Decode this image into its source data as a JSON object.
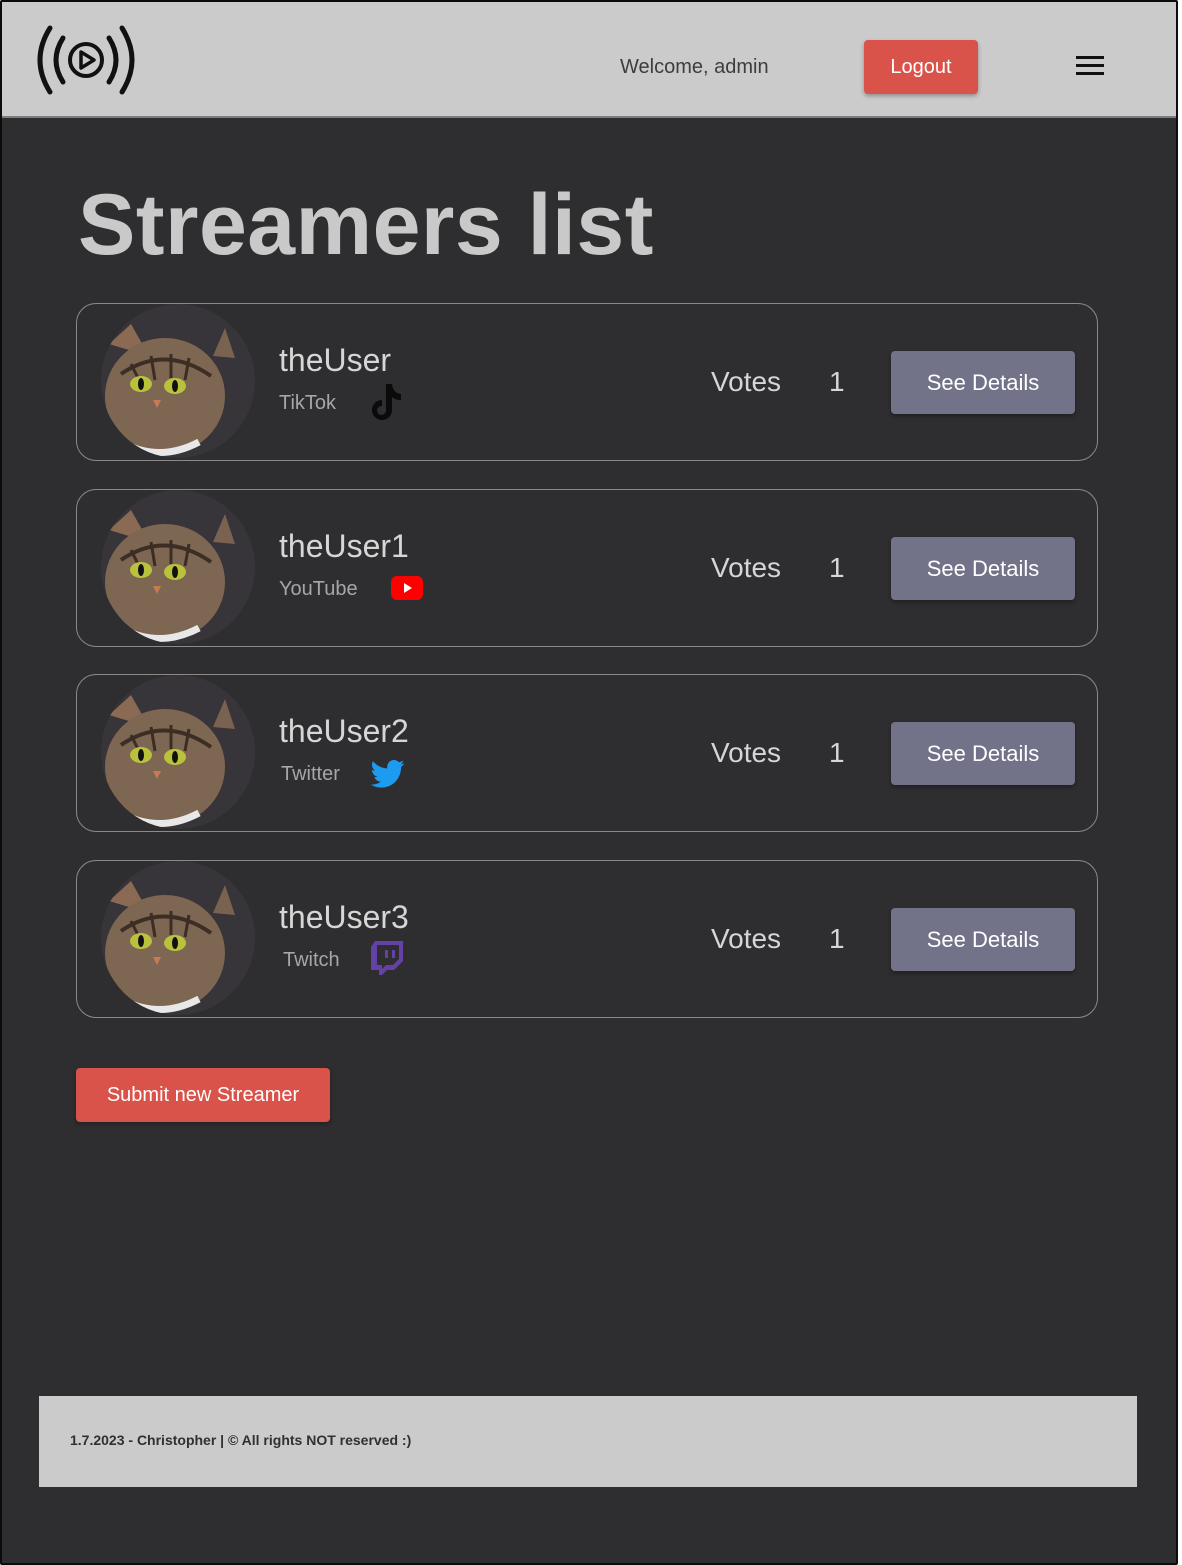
{
  "header": {
    "welcome_text": "Welcome, admin",
    "logout_label": "Logout"
  },
  "page": {
    "title": "Streamers list",
    "votes_label": "Votes",
    "details_label": "See Details",
    "submit_label": "Submit new Streamer"
  },
  "streamers": [
    {
      "name": "theUser",
      "platform": "TikTok",
      "icon": "tiktok-icon",
      "votes": "1"
    },
    {
      "name": "theUser1",
      "platform": "YouTube",
      "icon": "youtube-icon",
      "votes": "1"
    },
    {
      "name": "theUser2",
      "platform": "Twitter",
      "icon": "twitter-icon",
      "votes": "1"
    },
    {
      "name": "theUser3",
      "platform": "Twitch",
      "icon": "twitch-icon",
      "votes": "1"
    }
  ],
  "footer": {
    "text": "1.7.2023 - Christopher | © All rights NOT reserved :)"
  },
  "colors": {
    "header_bg": "#cbcbcb",
    "page_bg": "#2e2e30",
    "accent_red": "#d9534a",
    "details_button": "#727289",
    "youtube_red": "#ff0000",
    "twitter_blue": "#1d9bf0",
    "twitch_purple": "#6441a5"
  }
}
